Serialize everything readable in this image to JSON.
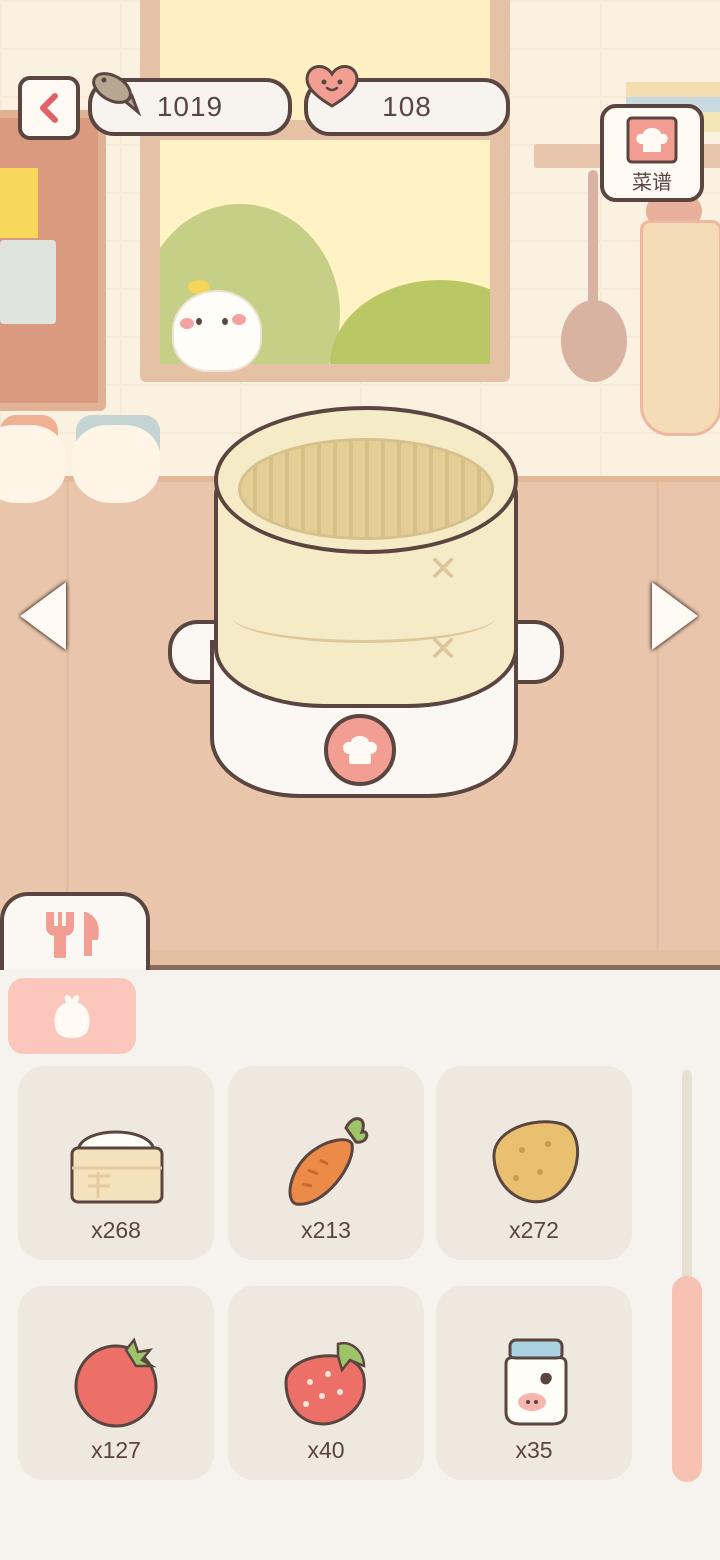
{
  "hud": {
    "fish_coins": "1019",
    "hearts": "108",
    "recipe_label": "菜谱"
  },
  "kitchen": {
    "appliance": "bamboo-steamer",
    "icons": {
      "back": "chevron-left-icon",
      "fish": "fish-icon",
      "heart": "heart-icon",
      "recipe": "recipe-book-icon",
      "cook": "chef-hat-icon",
      "prev": "arrow-left-icon",
      "next": "arrow-right-icon",
      "tools_tab": "utensils-icon",
      "category": "ingredient-icon"
    }
  },
  "ingredients": [
    {
      "name": "rice",
      "count": "x268"
    },
    {
      "name": "carrot",
      "count": "x213"
    },
    {
      "name": "potato",
      "count": "x272"
    },
    {
      "name": "tomato",
      "count": "x127"
    },
    {
      "name": "strawberry",
      "count": "x40"
    },
    {
      "name": "milk",
      "count": "x35"
    }
  ],
  "colors": {
    "outline": "#5b4541",
    "accent_pink": "#f29e93",
    "tab_pink": "#fbc6bb",
    "counter": "#e9c6ab",
    "slot": "#efe8de"
  }
}
